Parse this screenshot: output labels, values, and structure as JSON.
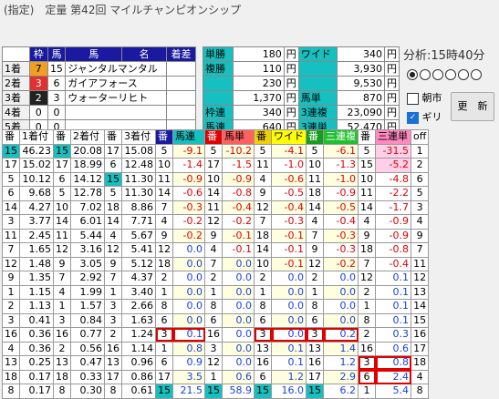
{
  "title": "(指定)　定量 第42回 マイルチャンピオンシップ",
  "result": {
    "headers": [
      "",
      "枠",
      "馬",
      "馬",
      "名",
      "着差"
    ],
    "rows": [
      {
        "pos": "1着",
        "waku": "7",
        "uma": "15",
        "name": "ジャンタルマンタル",
        "diff": ""
      },
      {
        "pos": "2着",
        "waku": "3",
        "uma": "6",
        "name": "ガイアフォース",
        "diff": ""
      },
      {
        "pos": "3着",
        "waku": "2",
        "uma": "3",
        "name": "ウォーターリヒト",
        "diff": ""
      },
      {
        "pos": "4着",
        "waku": "0",
        "uma": "0",
        "name": "",
        "diff": ""
      },
      {
        "pos": "5着",
        "waku": "0",
        "uma": "0",
        "name": "",
        "diff": ""
      }
    ]
  },
  "payout": {
    "tansho": {
      "label": "単勝",
      "val": "180",
      "unit": "円"
    },
    "fukusho": {
      "label": "複勝",
      "vals": [
        "110",
        "230",
        "1,370"
      ],
      "unit": "円"
    },
    "wakuren": {
      "label": "枠連",
      "val": "340",
      "unit": "円"
    },
    "umaren": {
      "label": "馬連",
      "val": "640",
      "unit": "円"
    },
    "wide": {
      "label": "ワイド",
      "vals": [
        "340",
        "3,930",
        "9,530"
      ],
      "unit": "円"
    },
    "umatan": {
      "label": "馬単",
      "val": "870",
      "unit": "円"
    },
    "sanrenpuku": {
      "label": "3連複",
      "val": "23,090",
      "unit": "円"
    },
    "sanrentan": {
      "label": "3連単",
      "val": "52,470",
      "unit": "円"
    }
  },
  "analysis": {
    "label": "分析:15時40分",
    "radios": 6,
    "asaichi": "朝市",
    "giri": "ギリ",
    "update_button": "更　新"
  },
  "grid": {
    "headers": [
      "番",
      "1着付",
      "番",
      "2着付",
      "番",
      "3着付",
      "番",
      "馬連",
      "番",
      "馬単",
      "番",
      "ワイド",
      "番",
      "三連複",
      "番",
      "三連単",
      "off"
    ],
    "rows": [
      [
        "15",
        "46.23",
        "15",
        "20.08",
        "17",
        "15.08",
        "5",
        "-9.1",
        "5",
        "-10.2",
        "5",
        "-4.1",
        "5",
        "-6.1",
        "5",
        "-31.5",
        "1"
      ],
      [
        "17",
        "15.02",
        "17",
        "18.99",
        "6",
        "12.48",
        "10",
        "-1.4",
        "17",
        "-1.5",
        "11",
        "-1.0",
        "10",
        "-1.3",
        "15",
        "-5.2",
        "2"
      ],
      [
        "5",
        "10.12",
        "6",
        "14.12",
        "15",
        "11.30",
        "11",
        "-0.9",
        "10",
        "-0.9",
        "4",
        "-0.6",
        "11",
        "-1.0",
        "10",
        "-4.8",
        "6"
      ],
      [
        "6",
        "9.68",
        "5",
        "12.78",
        "5",
        "11.30",
        "14",
        "-0.6",
        "14",
        "-0.8",
        "9",
        "-0.5",
        "18",
        "-0.9",
        "11",
        "-2.2",
        "5"
      ],
      [
        "14",
        "4.27",
        "10",
        "7.02",
        "18",
        "8.86",
        "7",
        "-0.3",
        "11",
        "-0.4",
        "12",
        "-0.4",
        "14",
        "-0.5",
        "14",
        "-1.7",
        "3"
      ],
      [
        "3",
        "3.77",
        "14",
        "6.01",
        "14",
        "7.71",
        "4",
        "-0.2",
        "12",
        "-0.2",
        "7",
        "-0.3",
        "4",
        "-0.4",
        "4",
        "-0.9",
        "4"
      ],
      [
        "11",
        "2.45",
        "11",
        "5.44",
        "4",
        "5.67",
        "9",
        "-0.2",
        "9",
        "-0.1",
        "18",
        "-0.1",
        "7",
        "-0.3",
        "9",
        "-0.9",
        "9"
      ],
      [
        "7",
        "1.65",
        "12",
        "3.16",
        "12",
        "5.41",
        "12",
        "0.0",
        "4",
        "-0.1",
        "14",
        "-0.1",
        "9",
        "-0.3",
        "18",
        "-0.8",
        "7"
      ],
      [
        "12",
        "1.48",
        "9",
        "3.05",
        "9",
        "5.12",
        "18",
        "0.0",
        "7",
        "0.0",
        "10",
        "-0.1",
        "12",
        "-0.2",
        "7",
        "-0.4",
        "11"
      ],
      [
        "9",
        "1.35",
        "7",
        "2.92",
        "7",
        "4.37",
        "2",
        "0.0",
        "2",
        "0.0",
        "2",
        "0.0",
        "2",
        "0.0",
        "12",
        "0.1",
        "12"
      ],
      [
        "1",
        "1.15",
        "4",
        "1.99",
        "1",
        "3.40",
        "1",
        "0.0",
        "1",
        "0.0",
        "1",
        "0.0",
        "1",
        "0.0",
        "2",
        "0.1",
        "13"
      ],
      [
        "2",
        "1.13",
        "1",
        "1.57",
        "3",
        "2.66",
        "8",
        "0.0",
        "8",
        "0.0",
        "8",
        "0.0",
        "8",
        "0.0",
        "1",
        "0.1",
        "14"
      ],
      [
        "3",
        "0.41",
        "3",
        "0.84",
        "3",
        "1.63",
        "6",
        "0.0",
        "6",
        "0.0",
        "6",
        "0.0",
        "6",
        "0.0",
        "8",
        "0.1",
        "15"
      ],
      [
        "16",
        "0.36",
        "16",
        "0.77",
        "2",
        "1.24",
        "3",
        "0.1",
        "16",
        "0.0",
        "3",
        "0.0",
        "3",
        "0.2",
        "2",
        "0.3",
        "16"
      ],
      [
        "4",
        "0.36",
        "2",
        "0.56",
        "16",
        "1.14",
        "1",
        "0.8",
        "3",
        "0.0",
        "13",
        "0.1",
        "13",
        "1.4",
        "16",
        "0.6",
        "17"
      ],
      [
        "13",
        "0.25",
        "13",
        "0.47",
        "13",
        "0.96",
        "6",
        "0.9",
        "12",
        "0.0",
        "16",
        "0.1",
        "16",
        "1.2",
        "3",
        "0.8",
        "18"
      ],
      [
        "18",
        "0.17",
        "18",
        "0.33",
        "17",
        "0.86",
        "17",
        "3.5",
        "1",
        "0.6",
        "6",
        "1.2",
        "17",
        "2.9",
        "6",
        "2.4",
        "4"
      ],
      [
        "8",
        "0.17",
        "8",
        "0.30",
        "8",
        "0.61",
        "15",
        "21.5",
        "15",
        "58.9",
        "15",
        "16.0",
        "15",
        "6.2",
        "1",
        "5.4",
        "8"
      ]
    ]
  },
  "colors": {
    "blue": "#1a1aa0",
    "cyan": "#16c0c0",
    "red": "#e00000",
    "neg": "#e00000",
    "pos": "#1a40e0"
  }
}
